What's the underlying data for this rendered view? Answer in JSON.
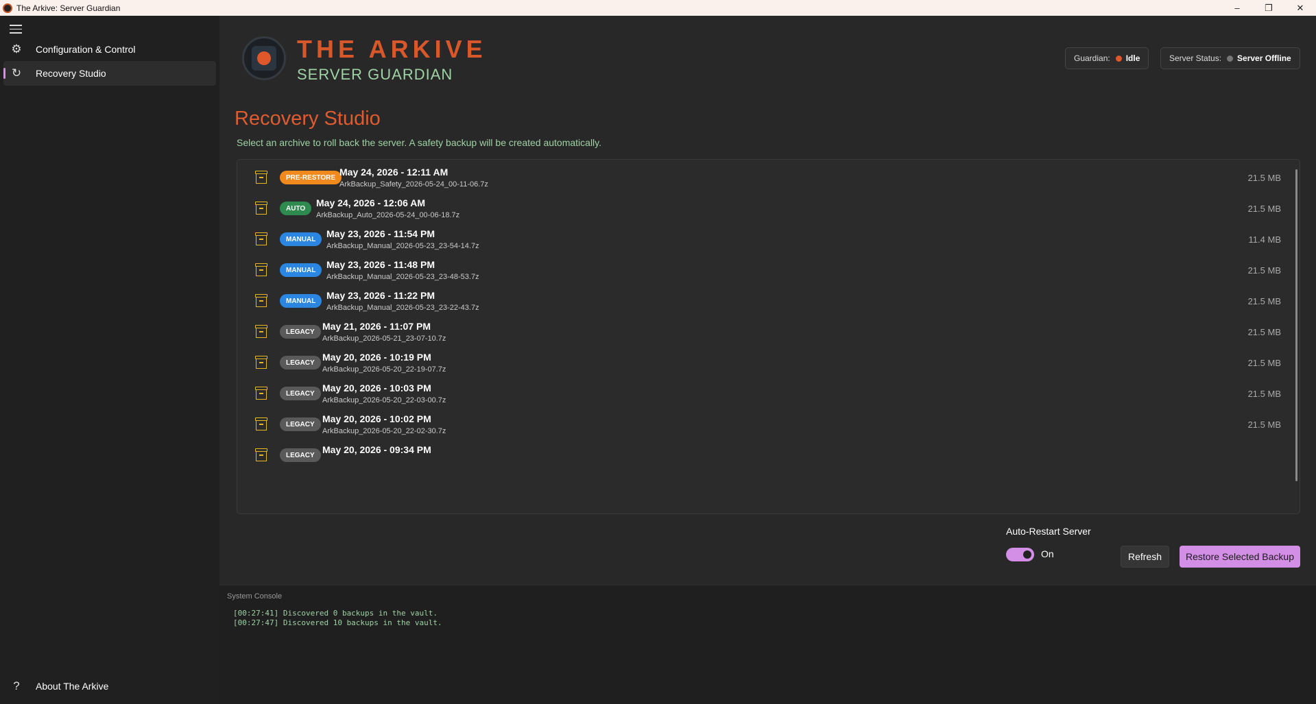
{
  "window": {
    "title": "The Arkive: Server Guardian",
    "controls": [
      "–",
      "❐",
      "✕"
    ]
  },
  "sidebar": {
    "items": [
      {
        "label": "Configuration & Control",
        "icon": "gear-icon"
      },
      {
        "label": "Recovery Studio",
        "icon": "refresh-icon"
      }
    ],
    "footer": {
      "label": "About The Arkive",
      "icon": "question-icon"
    }
  },
  "header": {
    "brand_title": "THE ARKIVE",
    "brand_subtitle": "SERVER GUARDIAN",
    "guardian": {
      "label": "Guardian:",
      "value": "Idle",
      "color": "#e0572a"
    },
    "server": {
      "label": "Server Status:",
      "value": "Server Offline",
      "color": "#777777"
    }
  },
  "page": {
    "title": "Recovery Studio",
    "description": "Select an archive to roll back the server. A safety backup will be created automatically."
  },
  "badge_colors": {
    "PRE-RESTORE": "#f08a1c",
    "AUTO": "#2e8a4e",
    "MANUAL": "#2a86e0",
    "LEGACY": "#5a5a5a"
  },
  "backups": [
    {
      "type": "PRE-RESTORE",
      "date": "May 24, 2026 - 12:11 AM",
      "file": "ArkBackup_Safety_2026-05-24_00-11-06.7z",
      "size": "21.5 MB"
    },
    {
      "type": "AUTO",
      "date": "May 24, 2026 - 12:06 AM",
      "file": "ArkBackup_Auto_2026-05-24_00-06-18.7z",
      "size": "21.5 MB"
    },
    {
      "type": "MANUAL",
      "date": "May 23, 2026 - 11:54 PM",
      "file": "ArkBackup_Manual_2026-05-23_23-54-14.7z",
      "size": "11.4 MB"
    },
    {
      "type": "MANUAL",
      "date": "May 23, 2026 - 11:48 PM",
      "file": "ArkBackup_Manual_2026-05-23_23-48-53.7z",
      "size": "21.5 MB"
    },
    {
      "type": "MANUAL",
      "date": "May 23, 2026 - 11:22 PM",
      "file": "ArkBackup_Manual_2026-05-23_23-22-43.7z",
      "size": "21.5 MB"
    },
    {
      "type": "LEGACY",
      "date": "May 21, 2026 - 11:07 PM",
      "file": "ArkBackup_2026-05-21_23-07-10.7z",
      "size": "21.5 MB"
    },
    {
      "type": "LEGACY",
      "date": "May 20, 2026 - 10:19 PM",
      "file": "ArkBackup_2026-05-20_22-19-07.7z",
      "size": "21.5 MB"
    },
    {
      "type": "LEGACY",
      "date": "May 20, 2026 - 10:03 PM",
      "file": "ArkBackup_2026-05-20_22-03-00.7z",
      "size": "21.5 MB"
    },
    {
      "type": "LEGACY",
      "date": "May 20, 2026 - 10:02 PM",
      "file": "ArkBackup_2026-05-20_22-02-30.7z",
      "size": "21.5 MB"
    },
    {
      "type": "LEGACY",
      "date": "May 20, 2026 - 09:34 PM",
      "file": "",
      "size": ""
    }
  ],
  "controls": {
    "auto_restart_label": "Auto-Restart Server",
    "auto_restart_state": "On",
    "refresh_label": "Refresh",
    "restore_label": "Restore Selected Backup"
  },
  "console": {
    "title": "System Console",
    "lines": [
      "[00:27:41] Discovered 0 backups in the vault.",
      "[00:27:47] Discovered 10 backups in the vault."
    ]
  }
}
